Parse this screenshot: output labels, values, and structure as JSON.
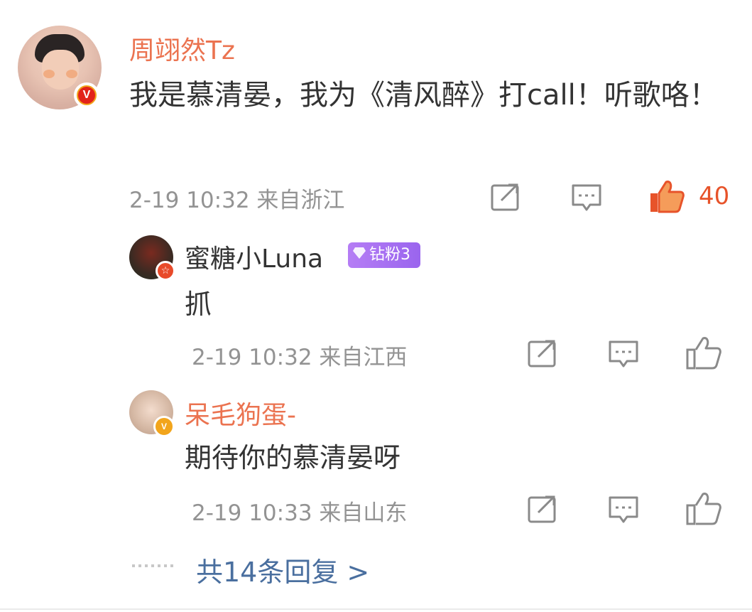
{
  "main_comment": {
    "username": "周翊然Tz",
    "text": "我是慕清晏，我为《清风醉》打call！听歌咯！",
    "timestamp": "2-19 10:32 来自浙江",
    "like_count": "40",
    "colors": {
      "username": "#eb7350",
      "like": "#e7532a"
    }
  },
  "replies": [
    {
      "username": "蜜糖小Luna",
      "badge": "钻粉3",
      "text": "抓",
      "timestamp": "2-19 10:32 来自江西"
    },
    {
      "username": "呆毛狗蛋-",
      "text": "期待你的慕清晏呀",
      "timestamp": "2-19 10:33 来自山东"
    }
  ],
  "more_replies": "共14条回复 >"
}
